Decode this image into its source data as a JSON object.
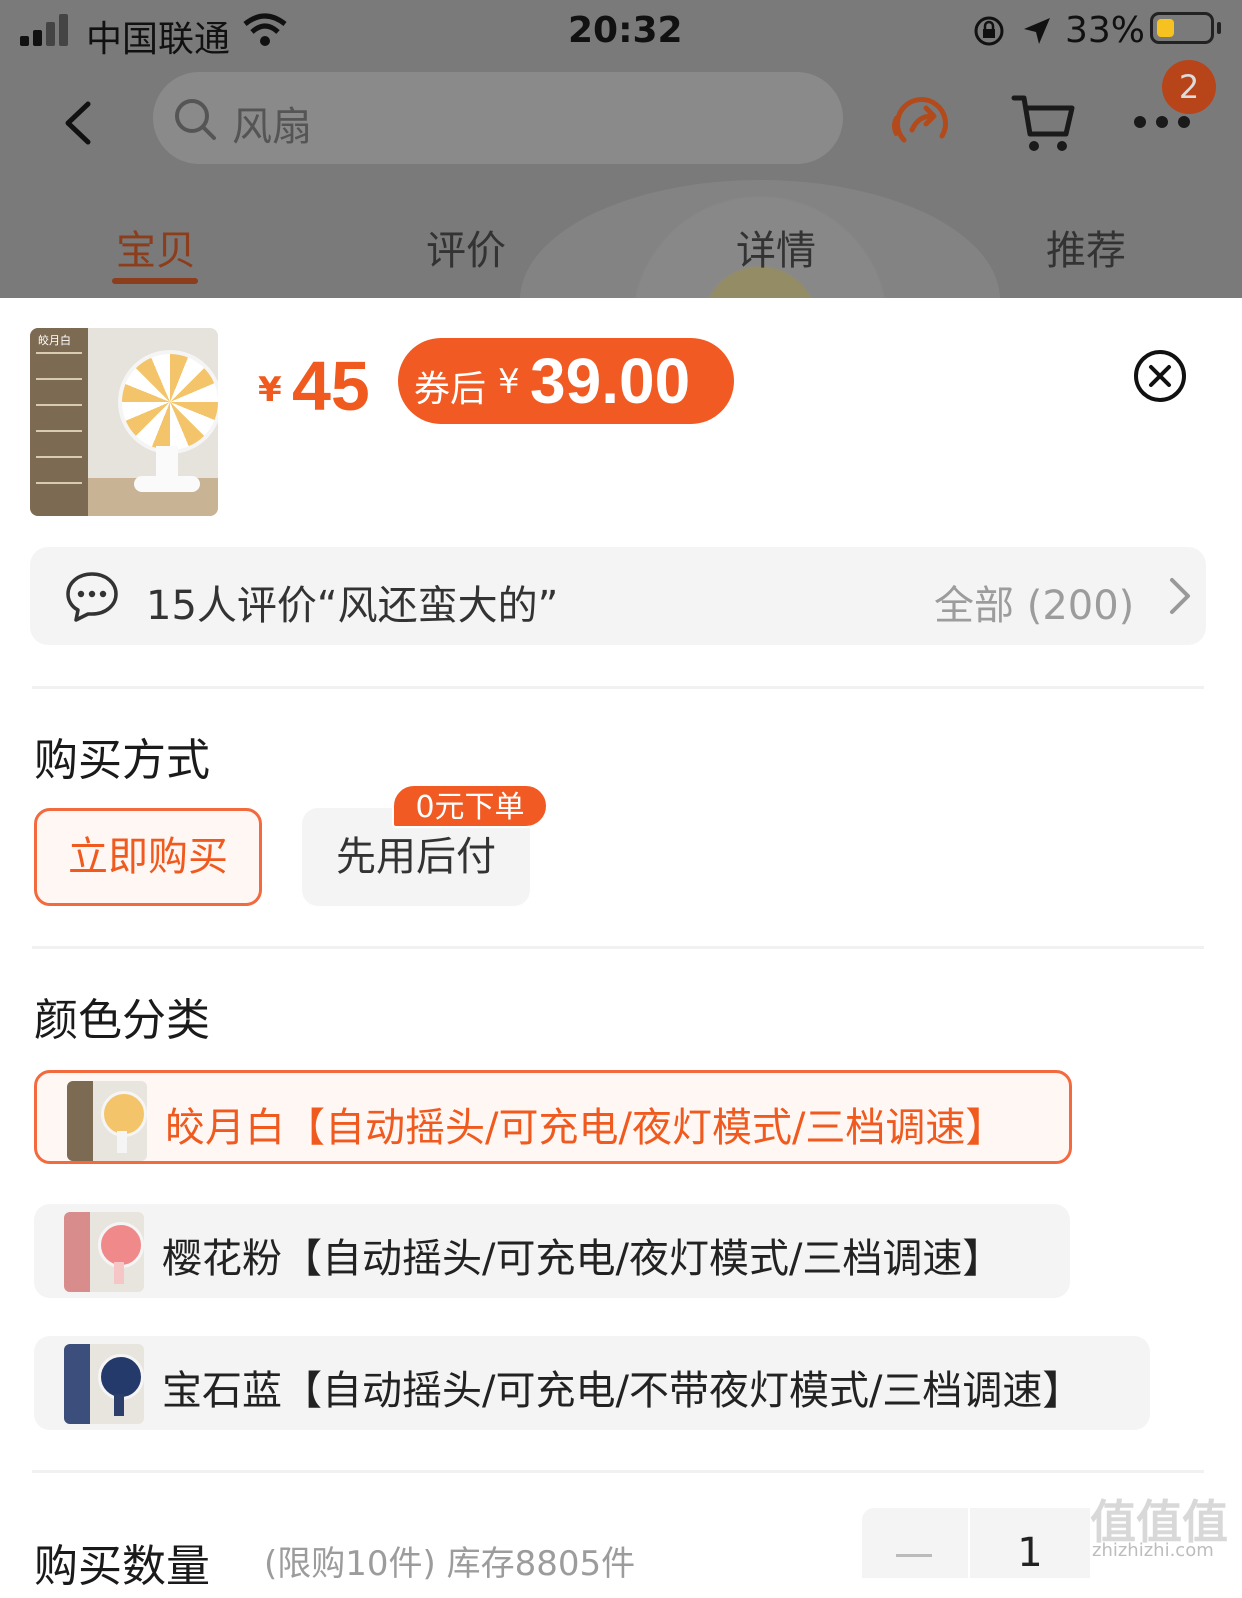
{
  "status_bar": {
    "carrier": "中国联通",
    "time": "20:32",
    "battery_percent": "33%",
    "battery_level": 0.33
  },
  "header": {
    "search_text": "风扇",
    "message_badge": "2",
    "tabs": [
      "宝贝",
      "评价",
      "详情",
      "推荐"
    ],
    "active_tab": "宝贝"
  },
  "product": {
    "currency": "¥",
    "price": "45",
    "coupon_label": "券后",
    "coupon_currency": "¥",
    "coupon_price": "39.00",
    "thumb_caption": "皎月白"
  },
  "review": {
    "summary": "15人评价“风还蛮大的”",
    "all_label": "全部 (200)"
  },
  "purchase_method": {
    "title": "购买方式",
    "options": [
      "立即购买",
      "先用后付"
    ],
    "selected": "立即购买",
    "badge": "0元下单"
  },
  "color": {
    "title": "颜色分类",
    "options": [
      {
        "label": "皎月白【自动摇头/可充电/夜灯模式/三档调速】",
        "selected": true,
        "fan_color": "#f3c46a",
        "strip_color": "#7d6a52"
      },
      {
        "label": "樱花粉【自动摇头/可充电/夜灯模式/三档调速】",
        "selected": false,
        "fan_color": "#f08a8a",
        "strip_color": "#d98c8c"
      },
      {
        "label": "宝石蓝【自动摇头/可充电/不带夜灯模式/三档调速】",
        "selected": false,
        "fan_color": "#243a6b",
        "strip_color": "#3c4f7c"
      }
    ]
  },
  "quantity": {
    "title": "购买数量",
    "limit_text": "(限购10件) 库存8805件",
    "minus": "—",
    "value": "1"
  },
  "watermark": {
    "main": "值值值",
    "sub": "zhizhizhi.com"
  },
  "colors": {
    "accent": "#f05a1e",
    "coupon_bg": "#f15a22"
  }
}
